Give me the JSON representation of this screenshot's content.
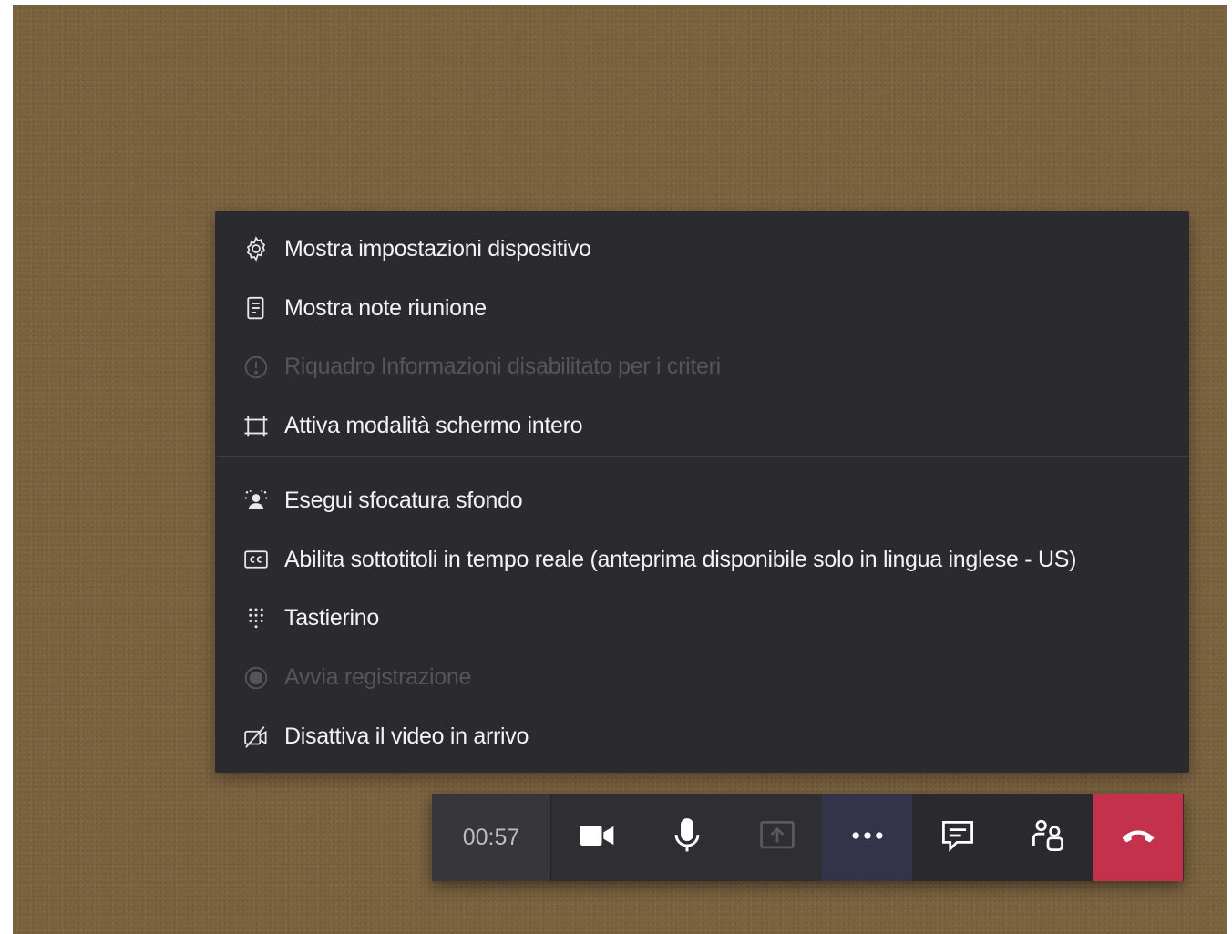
{
  "menu": {
    "items": [
      {
        "label": "Mostra impostazioni dispositivo",
        "icon": "gear-icon",
        "enabled": true
      },
      {
        "label": "Mostra note riunione",
        "icon": "meeting-notes-icon",
        "enabled": true
      },
      {
        "label": "Riquadro Informazioni disabilitato per i criteri",
        "icon": "info-icon",
        "enabled": false
      },
      {
        "label": "Attiva modalità schermo intero",
        "icon": "fullscreen-icon",
        "enabled": true
      },
      {
        "label": "Esegui sfocatura sfondo",
        "icon": "background-blur-icon",
        "enabled": true
      },
      {
        "label": "Abilita sottotitoli in tempo reale (anteprima disponibile solo in lingua inglese - US)",
        "icon": "closed-captions-icon",
        "enabled": true
      },
      {
        "label": "Tastierino",
        "icon": "dialpad-icon",
        "enabled": true
      },
      {
        "label": "Avvia registrazione",
        "icon": "record-icon",
        "enabled": false
      },
      {
        "label": "Disattiva il video in arrivo",
        "icon": "video-off-icon",
        "enabled": true
      }
    ]
  },
  "toolbar": {
    "timer": "00:57",
    "buttons": [
      {
        "name": "camera-button",
        "icon": "video-camera-icon"
      },
      {
        "name": "microphone-button",
        "icon": "microphone-icon"
      },
      {
        "name": "share-screen-button",
        "icon": "share-screen-icon",
        "enabled": false
      },
      {
        "name": "more-actions-button",
        "icon": "ellipsis-icon"
      },
      {
        "name": "chat-button",
        "icon": "chat-icon"
      },
      {
        "name": "participants-button",
        "icon": "participants-icon"
      },
      {
        "name": "hang-up-button",
        "icon": "hang-up-icon"
      }
    ]
  },
  "colors": {
    "background": "#7c6340",
    "menu_bg": "#2b2a2e",
    "text": "#f3f3f3",
    "disabled_text": "#56555a",
    "hangup": "#c4314b",
    "more_active": "#33344a"
  }
}
